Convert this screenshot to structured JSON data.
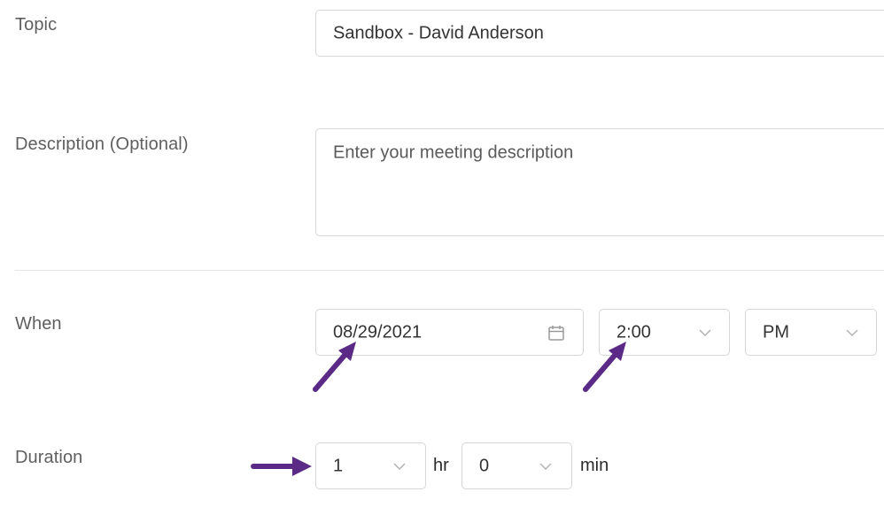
{
  "form": {
    "topic_label": "Topic",
    "topic_value": "Sandbox - David Anderson",
    "description_label": "Description (Optional)",
    "description_placeholder": "Enter your meeting description",
    "when_label": "When",
    "date_value": "08/29/2021",
    "time_value": "2:00",
    "ampm_value": "PM",
    "duration_label": "Duration",
    "hours_value": "1",
    "hours_unit": "hr",
    "minutes_value": "0",
    "minutes_unit": "min"
  },
  "icons": {
    "date_picker": "calendar-icon",
    "dropdown": "chevron-down-icon",
    "annotation": "arrow-icon"
  },
  "colors": {
    "annotation_arrow": "#5b2a86",
    "border": "#d6d6d6",
    "label_text": "#5f5f5f"
  }
}
